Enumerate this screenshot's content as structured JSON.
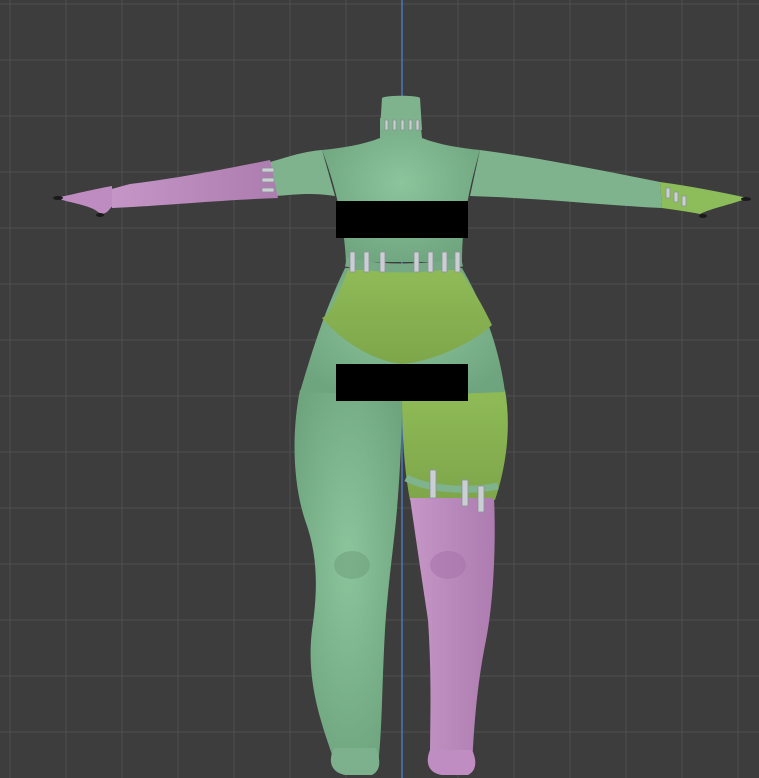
{
  "viewport": {
    "background": "#3d3d3d",
    "grid_color": "#4f4f4f",
    "center_axis_color": "#4a78b8"
  },
  "model": {
    "skin_colors": {
      "base_green": "#7fb38e",
      "lime_green": "#89b454",
      "pink": "#bb88bd",
      "staple_silver": "#c9cfd2",
      "nail_black": "#1a1a1a"
    }
  },
  "censor_bars": {
    "color": "#000000",
    "count": 2
  }
}
